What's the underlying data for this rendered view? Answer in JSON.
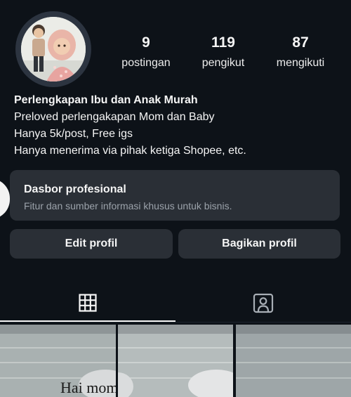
{
  "profile": {
    "stats": [
      {
        "value": "9",
        "label": "postingan"
      },
      {
        "value": "119",
        "label": "pengikut"
      },
      {
        "value": "87",
        "label": "mengikuti"
      }
    ],
    "name": "Perlengkapan Ibu dan Anak Murah",
    "bio_lines": [
      "Preloved perlengakapan Mom dan Baby",
      "Hanya 5k/post, Free igs",
      "Hanya menerima via pihak ketiga Shopee, etc."
    ]
  },
  "dashboard": {
    "title": "Dasbor profesional",
    "subtitle": "Fitur dan sumber informasi khusus untuk bisnis."
  },
  "actions": {
    "edit_label": "Edit profil",
    "share_label": "Bagikan profil"
  },
  "tabs": [
    {
      "icon": "grid-icon",
      "selected": true
    },
    {
      "icon": "tagged-person-icon",
      "selected": false
    }
  ],
  "posts": {
    "first_caption": "Hai moms mau"
  },
  "colors": {
    "background": "#0d1218",
    "card": "#2a2f36",
    "text": "#f5f5f5",
    "muted_text": "#9ba2aa"
  }
}
